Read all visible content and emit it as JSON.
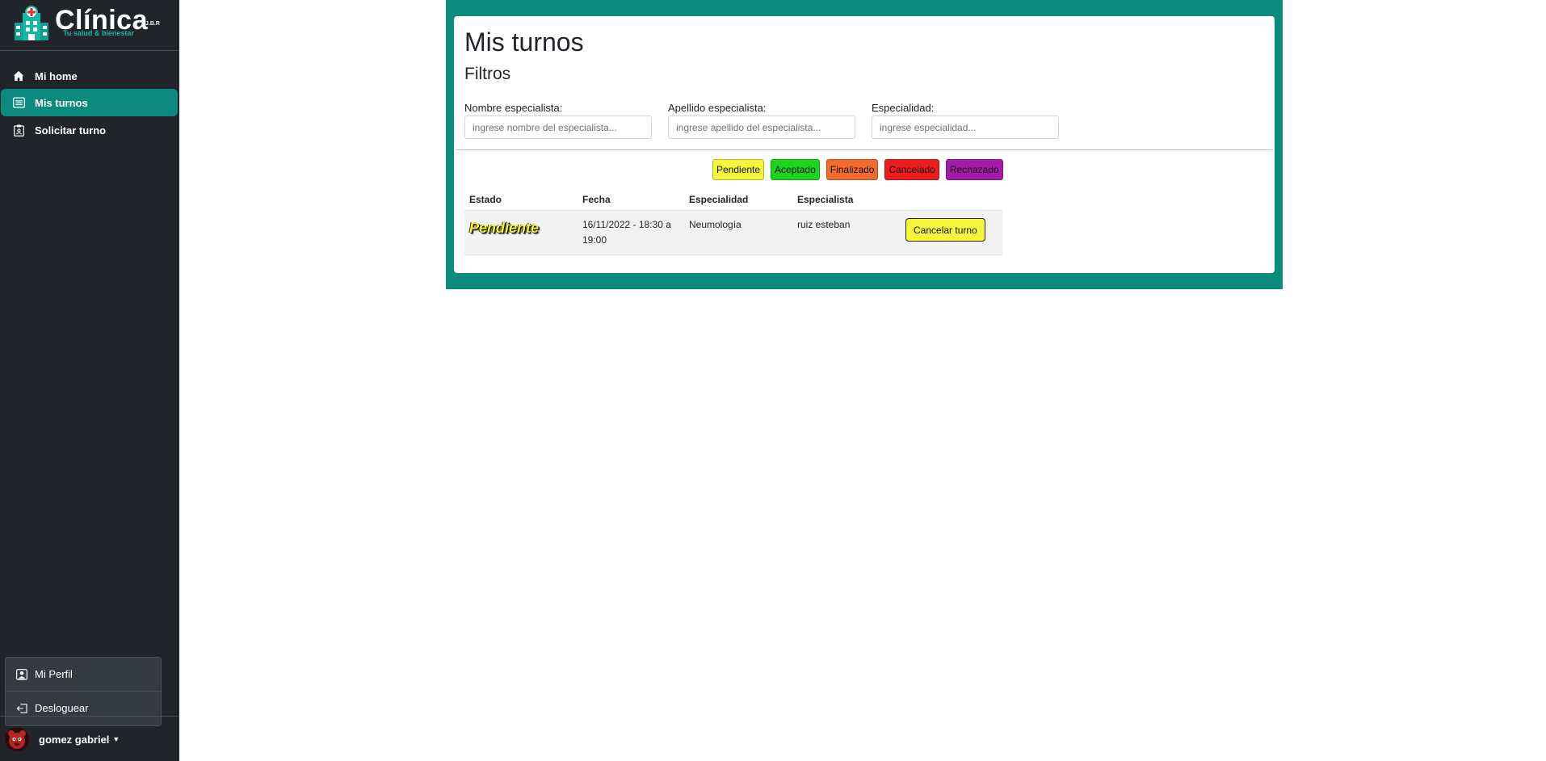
{
  "app": {
    "brand": "Clínica",
    "brand_suffix": "J.B.R",
    "tagline": "Tu salud & bienestar"
  },
  "sidebar": {
    "items": [
      {
        "label": "Mi home",
        "icon": "home-icon",
        "active": false
      },
      {
        "label": "Mis turnos",
        "icon": "list-icon",
        "active": true
      },
      {
        "label": "Solicitar turno",
        "icon": "clipboard-icon",
        "active": false
      }
    ],
    "profile_menu": [
      {
        "label": "Mi Perfil",
        "icon": "person-icon"
      },
      {
        "label": "Desloguear",
        "icon": "logout-icon"
      }
    ],
    "user_name": "gomez gabriel"
  },
  "main": {
    "title": "Mis turnos",
    "filters_title": "Filtros",
    "filters": [
      {
        "label": "Nombre especialista:",
        "placeholder": "ingrese nombre del especialista...",
        "value": ""
      },
      {
        "label": "Apellido especialista:",
        "placeholder": "ingrese apellido del especialista...",
        "value": ""
      },
      {
        "label": "Especialidad:",
        "placeholder": "ingrese especialidad...",
        "value": ""
      }
    ],
    "status_legend": [
      {
        "label": "Pendiente",
        "color": "#f6f53a"
      },
      {
        "label": "Aceptado",
        "color": "#1ed51e"
      },
      {
        "label": "Finalizado",
        "color": "#f26a2e"
      },
      {
        "label": "Cancelado",
        "color": "#ee1c1c"
      },
      {
        "label": "Rechazado",
        "color": "#a51aa8"
      }
    ],
    "table": {
      "headers": [
        "Estado",
        "Fecha",
        "Especialidad",
        "Especialista"
      ],
      "rows": [
        {
          "estado": "Pendiente",
          "fecha": "16/11/2022 - 18:30 a 19:00",
          "especialidad": "Neumología",
          "especialista": "ruiz esteban",
          "action_label": "Cancelar turno"
        }
      ]
    }
  },
  "colors": {
    "sidebar_bg": "#212529",
    "accent": "#0b8a7e",
    "pending": "#f6f53a"
  }
}
